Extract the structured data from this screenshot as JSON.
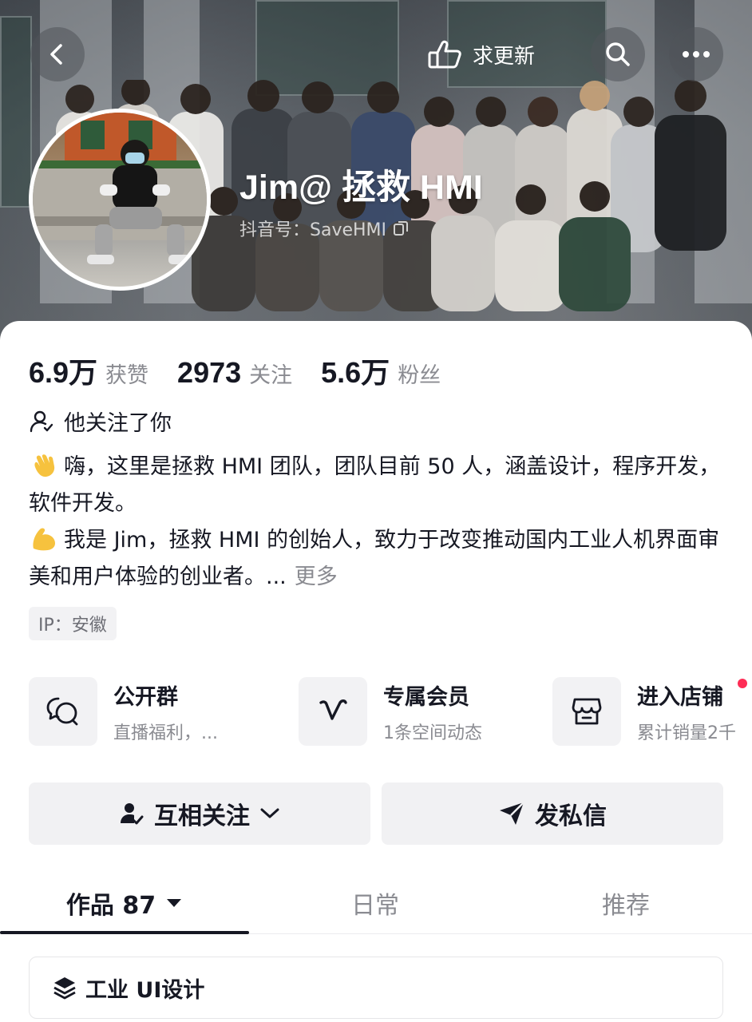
{
  "header": {
    "action_label": "求更新",
    "profile_name": "Jim@ 拯救 HMI",
    "profile_id": "抖音号：SaveHMI"
  },
  "stats": [
    {
      "value": "6.9万",
      "label": "获赞"
    },
    {
      "value": "2973",
      "label": "关注"
    },
    {
      "value": "5.6万",
      "label": "粉丝"
    }
  ],
  "follow_note": "他关注了你",
  "bio": {
    "line1": "嗨，这里是拯救 HMI 团队，团队目前 50 人，涵盖设计，程序开发，软件开发。",
    "line2": "我是 Jim，拯救 HMI 的创始人，致力于改变推动国内工业人机界面审美和用户体验的创业者。...",
    "more_label": "更多"
  },
  "ip_tag": "IP：安徽",
  "entries": [
    {
      "title": "公开群",
      "subtitle": "直播福利，...",
      "icon": "chat-bubbles-icon"
    },
    {
      "title": "专属会员",
      "subtitle": "1条空间动态",
      "icon": "v-badge-icon"
    },
    {
      "title": "进入店铺",
      "subtitle": "累计销量2千",
      "icon": "store-icon"
    }
  ],
  "buttons": {
    "follow": "互相关注",
    "message": "发私信"
  },
  "tabs": [
    {
      "label": "作品 87",
      "active": true
    },
    {
      "label": "日常",
      "active": false
    },
    {
      "label": "推荐",
      "active": false
    }
  ],
  "collection": {
    "label": "工业 UI设计"
  },
  "colors": {
    "accent_red": "#fe2c55",
    "text_primary": "#161823",
    "text_secondary": "#8a8b91",
    "button_bg": "#f1f1f3"
  }
}
